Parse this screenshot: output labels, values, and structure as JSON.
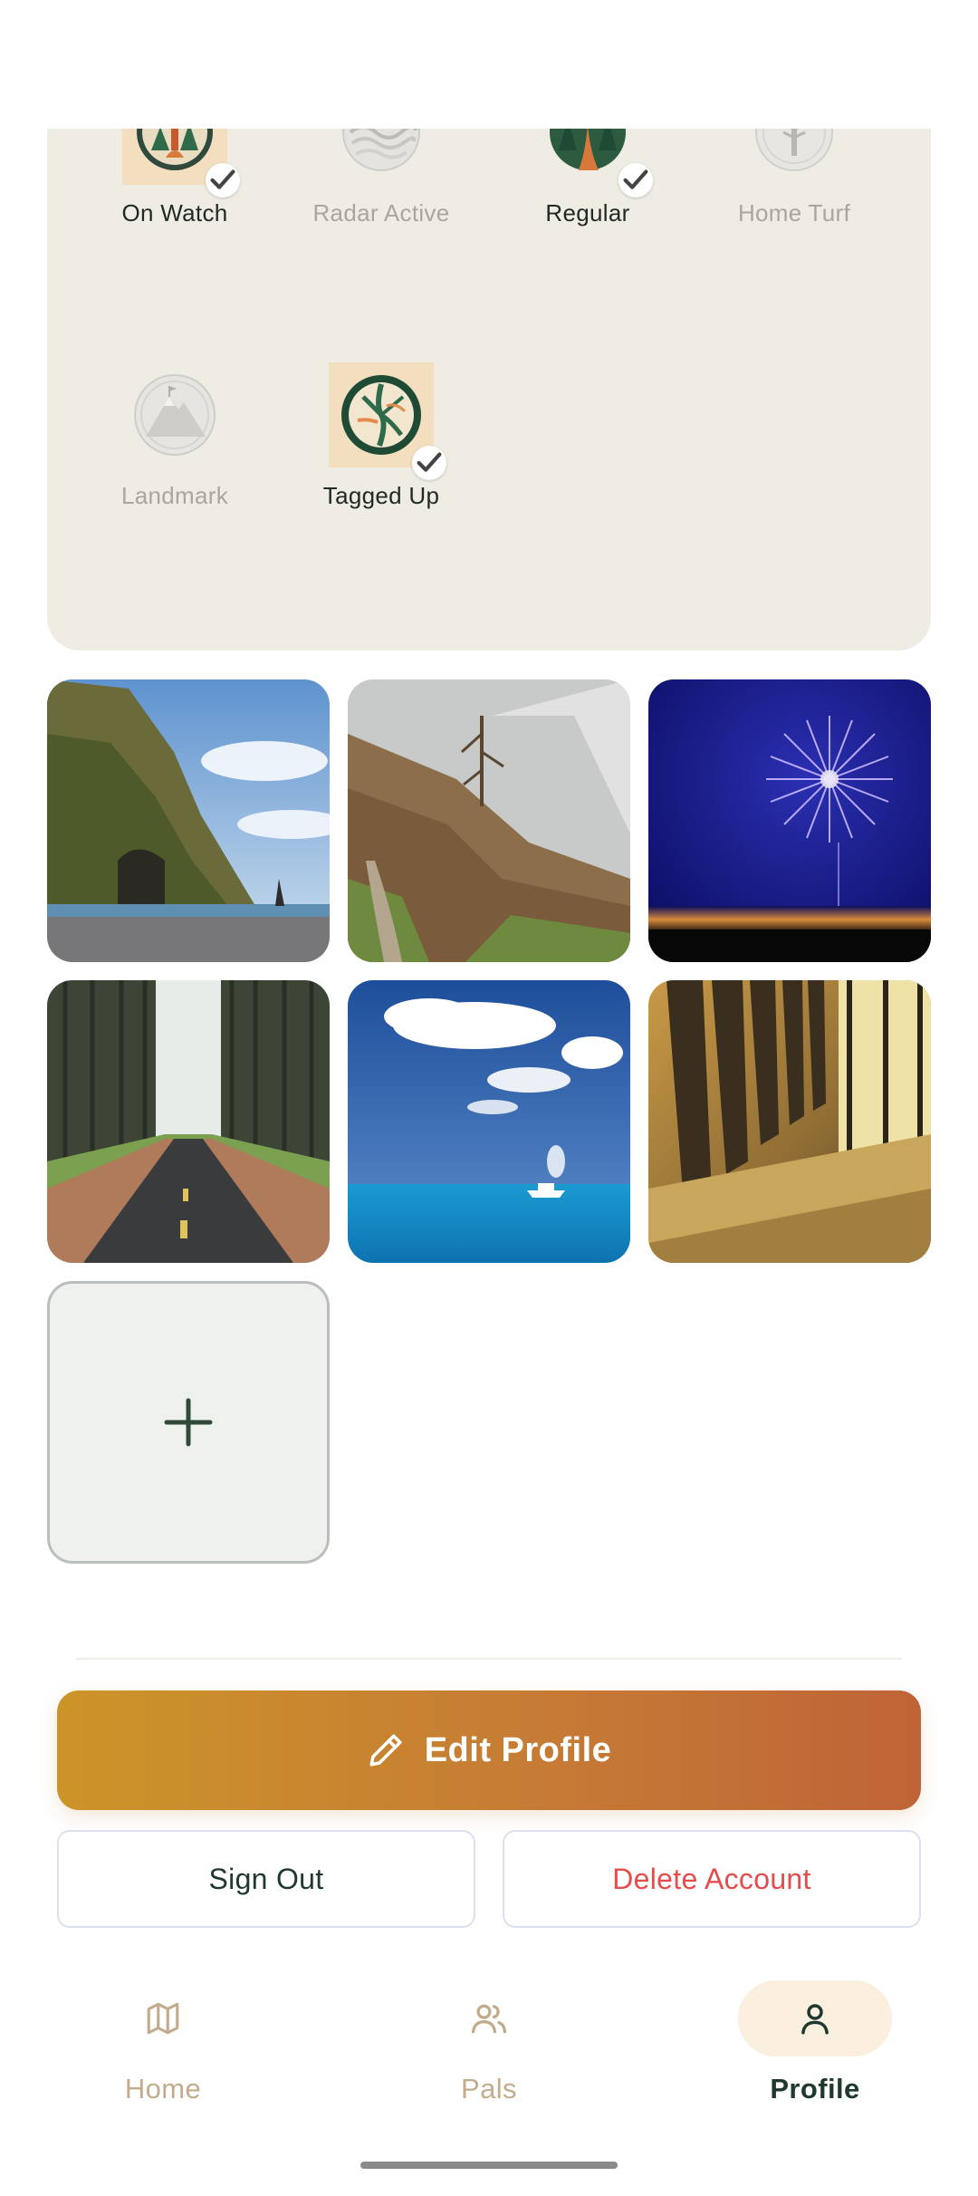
{
  "badges": [
    {
      "label": "On Watch",
      "earned": true,
      "icon": "forest-lookout-badge-icon"
    },
    {
      "label": "Radar Active",
      "earned": false,
      "icon": "waves-badge-icon"
    },
    {
      "label": "Regular",
      "earned": true,
      "icon": "forest-path-badge-icon"
    },
    {
      "label": "Home Turf",
      "earned": false,
      "icon": "tree-badge-icon"
    },
    {
      "label": "Landmark",
      "earned": false,
      "icon": "mountain-badge-icon"
    },
    {
      "label": "Tagged Up",
      "earned": true,
      "icon": "tree-rings-badge-icon"
    }
  ],
  "photos": [
    {
      "subject": "sea-cliff-beach"
    },
    {
      "subject": "misty-mountain-trail"
    },
    {
      "subject": "fireworks-night"
    },
    {
      "subject": "forest-road"
    },
    {
      "subject": "ocean-boat"
    },
    {
      "subject": "warm-seating-rows"
    }
  ],
  "add_photo": {
    "icon": "plus-icon"
  },
  "actions": {
    "edit_profile": "Edit Profile",
    "sign_out": "Sign Out",
    "delete_account": "Delete Account"
  },
  "nav": {
    "items": [
      {
        "label": "Home",
        "icon": "map-icon",
        "active": false
      },
      {
        "label": "Pals",
        "icon": "users-icon",
        "active": false
      },
      {
        "label": "Profile",
        "icon": "user-icon",
        "active": true
      }
    ]
  },
  "colors": {
    "accent_start": "#cc9428",
    "accent_end": "#bf6437",
    "danger": "#e54c4c",
    "primary_text": "#1f3a2c",
    "muted": "#c3ac8d"
  }
}
